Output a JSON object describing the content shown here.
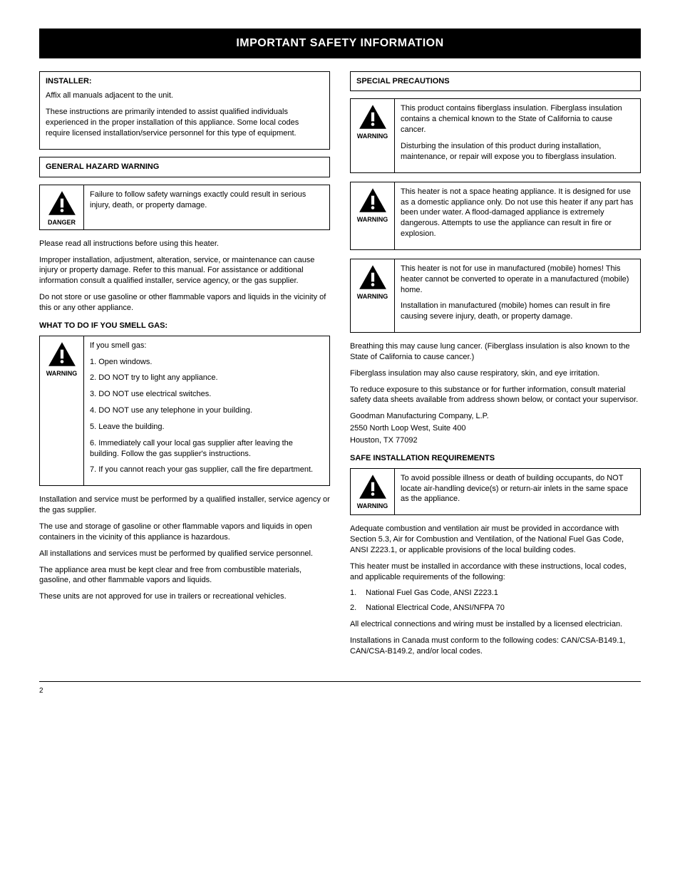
{
  "titleBar": "IMPORTANT SAFETY INFORMATION",
  "leftColumn": {
    "topBox": {
      "heading": "INSTALLER:",
      "lines": [
        "Affix all manuals adjacent to the unit.",
        "These instructions are primarily intended to assist qualified individuals experienced in the proper installation of this appliance. Some local codes require licensed installation/service personnel for this type of equipment."
      ]
    },
    "generalHeadingBox": "GENERAL HAZARD WARNING",
    "danger": {
      "label": "DANGER",
      "text": "Failure to follow safety warnings exactly could result in serious injury, death, or property damage."
    },
    "paragraphs1": [
      "Please read all instructions before using this heater.",
      "Improper installation, adjustment, alteration, service, or maintenance can cause injury or property damage. Refer to this manual. For assistance or additional information consult a qualified installer, service agency, or the gas supplier.",
      "Do not store or use gasoline or other flammable vapors and liquids in the vicinity of this or any other appliance."
    ],
    "subheading1": "WHAT TO DO IF YOU SMELL GAS:",
    "warning1": {
      "label": "WARNING",
      "text1": "If you smell gas:",
      "bullets": [
        "1. Open windows.",
        "2. DO NOT try to light any appliance.",
        "3. DO NOT use electrical switches.",
        "4. DO NOT use any telephone in your building.",
        "5. Leave the building.",
        "6. Immediately call your local gas supplier after leaving the building. Follow the gas supplier's instructions.",
        "7. If you cannot reach your gas supplier, call the fire department."
      ]
    },
    "paragraphs2": [
      "Installation and service must be performed by a qualified installer, service agency or the gas supplier.",
      "The use and storage of gasoline or other flammable vapors and liquids in open containers in the vicinity of this appliance is hazardous.",
      "All installations and services must be performed by qualified service personnel.",
      "The appliance area must be kept clear and free from combustible materials, gasoline, and other flammable vapors and liquids.",
      "These units are not approved for use in trailers or recreational vehicles."
    ]
  },
  "rightColumn": {
    "specialBox": "SPECIAL PRECAUTIONS",
    "warnA": {
      "label": "WARNING",
      "text": "This product contains fiberglass insulation. Fiberglass insulation contains a chemical known to the State of California to cause cancer.",
      "textB": "Disturbing the insulation of this product during installation, maintenance, or repair will expose you to fiberglass insulation."
    },
    "warnB": {
      "label": "WARNING",
      "text": "This heater is not a space heating appliance. It is designed for use as a domestic appliance only. Do not use this heater if any part has been under water. A flood-damaged appliance is extremely dangerous. Attempts to use the appliance can result in fire or explosion."
    },
    "warnC": {
      "label": "WARNING",
      "textA": "This heater is not for use in manufactured (mobile) homes! This heater cannot be converted to operate in a manufactured (mobile) home.",
      "textB": "Installation in manufactured (mobile) homes can result in fire causing severe injury, death, or property damage."
    },
    "afterWarnParagraphs": [
      "Breathing this may cause lung cancer. (Fiberglass insulation is also known to the State of California to cause cancer.)",
      "Fiberglass insulation may also cause respiratory, skin, and eye irritation."
    ],
    "precautionsHeading": "To reduce exposure to this substance or for further information, consult material safety data sheets available from address shown below, or contact your supervisor.",
    "address": [
      "Goodman Manufacturing Company, L.P.",
      "2550 North Loop West, Suite 400",
      "Houston, TX 77092"
    ],
    "settingsHeading": "SAFE INSTALLATION REQUIREMENTS",
    "warnD": {
      "label": "WARNING",
      "text": "To avoid possible illness or death of building occupants, do NOT locate air-handling device(s) or return-air inlets in the same space as the appliance."
    },
    "afterDParagraphs": [
      "Adequate combustion and ventilation air must be provided in accordance with Section 5.3, Air for Combustion and Ventilation, of the National Fuel Gas Code, ANSI Z223.1, or applicable provisions of the local building codes.",
      "This heater must be installed in accordance with these instructions, local codes, and applicable requirements of the following:"
    ],
    "codesList": [
      "National Fuel Gas Code, ANSI Z223.1",
      "National Electrical Code, ANSI/NFPA 70"
    ],
    "paragraphs3": [
      "All electrical connections and wiring must be installed by a licensed electrician.",
      "Installations in Canada must conform to the following codes: CAN/CSA-B149.1, CAN/CSA-B149.2, and/or local codes."
    ]
  },
  "footer": {
    "left": "2",
    "right": ""
  }
}
